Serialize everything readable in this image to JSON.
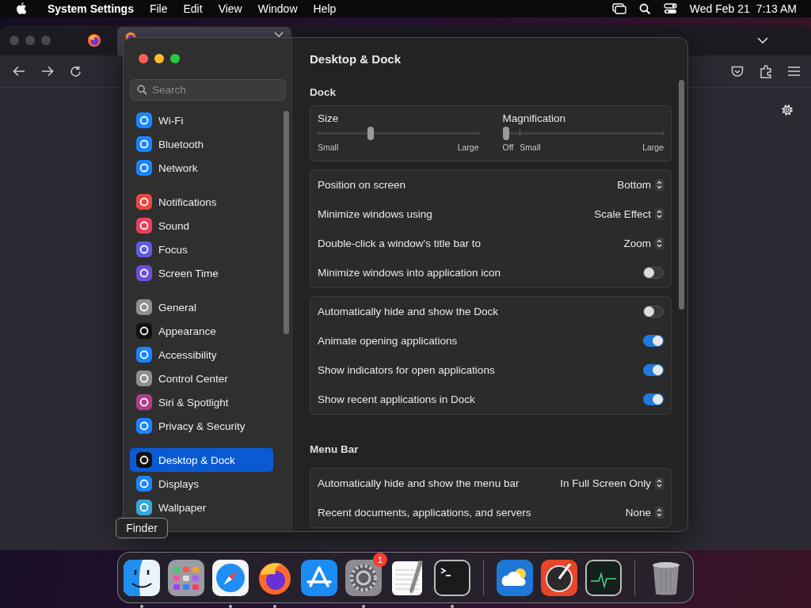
{
  "menubar": {
    "app_name": "System Settings",
    "menus": [
      "File",
      "Edit",
      "View",
      "Window",
      "Help"
    ],
    "clock": "Wed Feb 21  7:13 AM"
  },
  "settings": {
    "title": "Desktop & Dock",
    "search": {
      "placeholder": "Search"
    },
    "sidebar": {
      "groups": [
        {
          "items": [
            {
              "label": "Wi-Fi",
              "color": "#1a84ff",
              "selected": false
            },
            {
              "label": "Bluetooth",
              "color": "#1a84ff",
              "selected": false
            },
            {
              "label": "Network",
              "color": "#1a84ff",
              "selected": false
            }
          ]
        },
        {
          "items": [
            {
              "label": "Notifications",
              "color": "#e8483f",
              "selected": false
            },
            {
              "label": "Sound",
              "color": "#e8405c",
              "selected": false
            },
            {
              "label": "Focus",
              "color": "#5e5ce6",
              "selected": false
            },
            {
              "label": "Screen Time",
              "color": "#6e4fd8",
              "selected": false
            }
          ]
        },
        {
          "items": [
            {
              "label": "General",
              "color": "#8e8e93",
              "selected": false
            },
            {
              "label": "Appearance",
              "color": "#111111",
              "selected": false
            },
            {
              "label": "Accessibility",
              "color": "#1a84ff",
              "selected": false
            },
            {
              "label": "Control Center",
              "color": "#8e8e93",
              "selected": false
            },
            {
              "label": "Siri & Spotlight",
              "color": "#b03c8c",
              "selected": false
            },
            {
              "label": "Privacy & Security",
              "color": "#1a84ff",
              "selected": false
            }
          ]
        },
        {
          "items": [
            {
              "label": "Desktop & Dock",
              "color": "#111111",
              "selected": true
            },
            {
              "label": "Displays",
              "color": "#1a84ff",
              "selected": false
            },
            {
              "label": "Wallpaper",
              "color": "#34a8d8",
              "selected": false
            }
          ]
        }
      ]
    },
    "sections": [
      {
        "heading": "Dock",
        "sliders": [
          {
            "label": "Size",
            "level": 0.33,
            "scale": [
              "Small",
              "Large"
            ]
          },
          {
            "label": "Magnification",
            "level": 0,
            "scale": [
              "Off",
              "Small",
              "Large"
            ]
          }
        ],
        "groups": [
          {
            "rows": [
              {
                "kind": "popup",
                "label": "Position on screen",
                "value": "Bottom"
              },
              {
                "kind": "popup",
                "label": "Minimize windows using",
                "value": "Scale Effect"
              },
              {
                "kind": "popup",
                "label": "Double-click a window's title bar to",
                "value": "Zoom"
              },
              {
                "kind": "toggle",
                "label": "Minimize windows into application icon",
                "on": false
              }
            ]
          },
          {
            "rows": [
              {
                "kind": "toggle",
                "label": "Automatically hide and show the Dock",
                "on": false
              },
              {
                "kind": "toggle",
                "label": "Animate opening applications",
                "on": true
              },
              {
                "kind": "toggle",
                "label": "Show indicators for open applications",
                "on": true
              },
              {
                "kind": "toggle",
                "label": "Show recent applications in Dock",
                "on": true
              }
            ]
          }
        ]
      },
      {
        "heading": "Menu Bar",
        "groups": [
          {
            "rows": [
              {
                "kind": "popup",
                "label": "Automatically hide and show the menu bar",
                "value": "In Full Screen Only"
              },
              {
                "kind": "popup",
                "label": "Recent documents, applications, and servers",
                "value": "None"
              }
            ]
          }
        ]
      }
    ]
  },
  "dock": {
    "tooltip": "Finder",
    "items": [
      {
        "kind": "app",
        "running": true
      },
      {
        "kind": "app",
        "running": false
      },
      {
        "kind": "app",
        "running": true
      },
      {
        "kind": "app",
        "running": true
      },
      {
        "kind": "app",
        "running": false
      },
      {
        "kind": "app",
        "running": true,
        "badge": "1"
      },
      {
        "kind": "app",
        "running": false
      },
      {
        "kind": "app",
        "running": true
      },
      {
        "kind": "separator"
      },
      {
        "kind": "app",
        "running": false
      },
      {
        "kind": "app",
        "running": false
      },
      {
        "kind": "app",
        "running": false
      },
      {
        "kind": "separator"
      },
      {
        "kind": "trash",
        "running": false
      }
    ]
  }
}
